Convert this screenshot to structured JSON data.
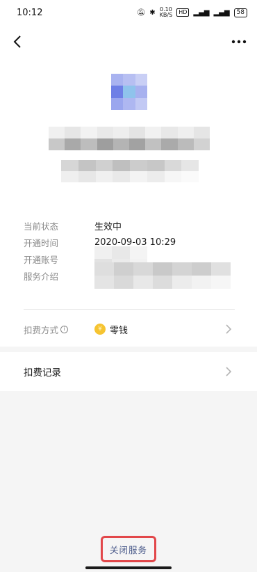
{
  "status_bar": {
    "time": "10:12",
    "speed": "0.10",
    "speed_unit": "KB/S",
    "battery": "58"
  },
  "details": {
    "status_label": "当前状态",
    "status_value": "生效中",
    "opened_time_label": "开通时间",
    "opened_time_value": "2020-09-03 10:29",
    "account_label": "开通账号",
    "service_intro_label": "服务介绍"
  },
  "payment": {
    "label": "扣费方式",
    "info_glyph": "i",
    "value": "零钱",
    "coin_glyph": "¥"
  },
  "records": {
    "label": "扣费记录"
  },
  "footer": {
    "close_service": "关闭服务"
  },
  "colors": {
    "highlight_border": "#e2474a",
    "close_text": "#4a5a8a",
    "coin": "#f6c431"
  },
  "icons": {
    "back": "back-arrow-icon",
    "more": "more-dots-icon",
    "chevron": "chevron-right-icon",
    "coin": "wallet-coin-icon"
  }
}
